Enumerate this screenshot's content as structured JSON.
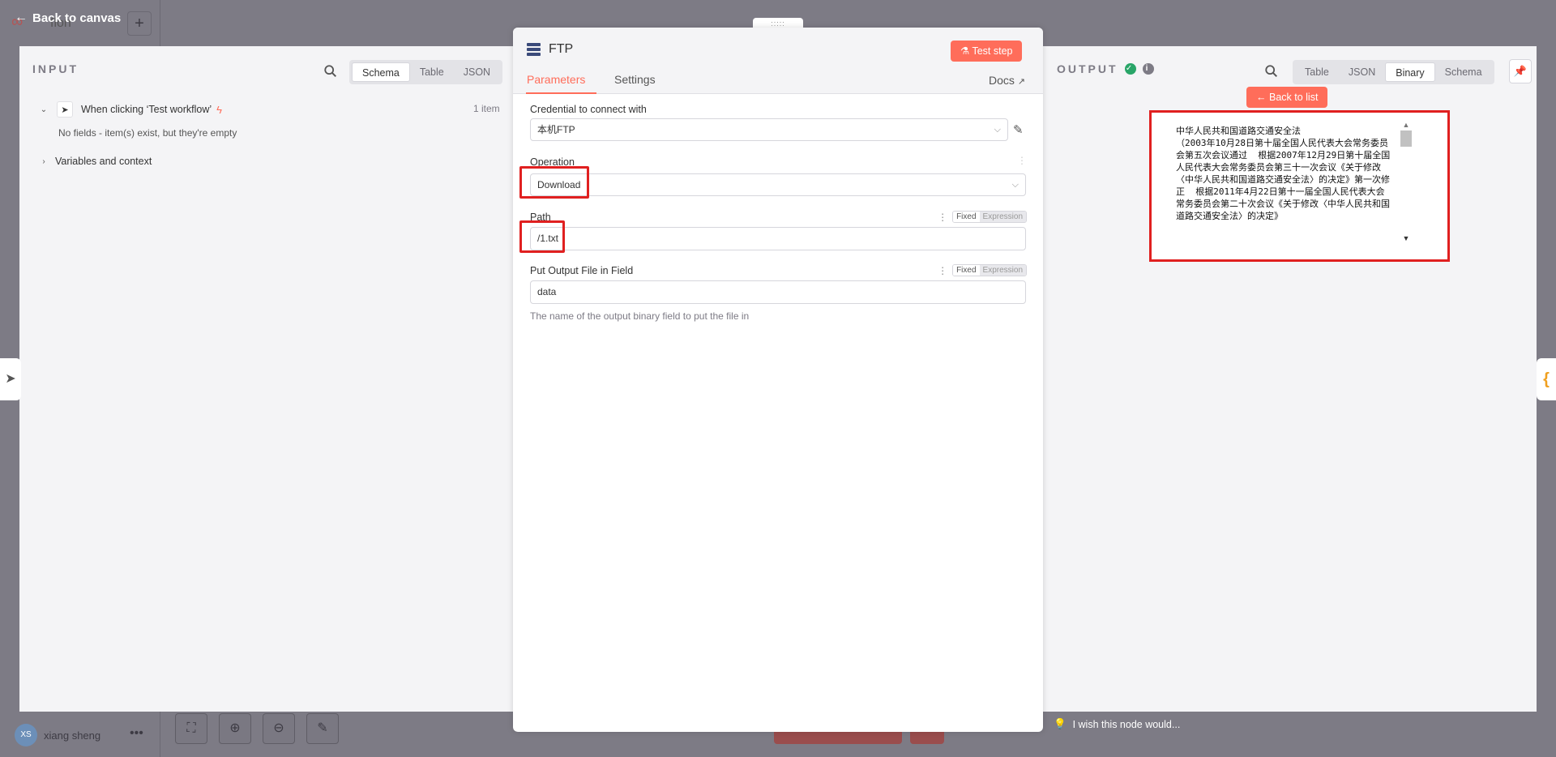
{
  "canvas": {
    "back_label": "Back to canvas",
    "workflow_title": "flon",
    "user_initials": "XS",
    "user_name": "xiang sheng",
    "more_label": "•••"
  },
  "input": {
    "title": "INPUT",
    "view_options": [
      "Schema",
      "Table",
      "JSON"
    ],
    "active_view": "Schema",
    "trigger_label": "When clicking ‘Test workflow’",
    "item_count": "1 item",
    "empty_message": "No fields - item(s) exist, but they're empty",
    "variables_label": "Variables and context"
  },
  "node": {
    "title": "FTP",
    "test_button": "Test step",
    "tabs": [
      "Parameters",
      "Settings"
    ],
    "active_tab": "Parameters",
    "docs_label": "Docs",
    "credential_label": "Credential to connect with",
    "credential_value": "本机FTP",
    "operation_label": "Operation",
    "operation_value": "Download",
    "path_label": "Path",
    "path_value": "/1.txt",
    "output_field_label": "Put Output File in Field",
    "output_field_value": "data",
    "output_field_hint": "The name of the output binary field to put the file in",
    "mode_fixed": "Fixed",
    "mode_expression": "Expression"
  },
  "output": {
    "title": "OUTPUT",
    "view_options": [
      "Table",
      "JSON",
      "Binary",
      "Schema"
    ],
    "active_view": "Binary",
    "back_to_list": "Back to list",
    "binary_content": "中华人民共和国道路交通安全法\n（2003年10月28日第十届全国人民代表大会常务委员会第五次会议通过  根据2007年12月29日第十届全国人民代表大会常务委员会第三十一次会议《关于修改〈中华人民共和国道路交通安全法〉的决定》第一次修正  根据2011年4月22日第十一届全国人民代表大会常务委员会第二十次会议《关于修改〈中华人民共和国道路交通安全法〉的决定》"
  },
  "footer": {
    "wish_label": "I wish this node would..."
  },
  "colors": {
    "accent": "#ff6d5a",
    "highlight": "#e02020",
    "success": "#29a568"
  }
}
